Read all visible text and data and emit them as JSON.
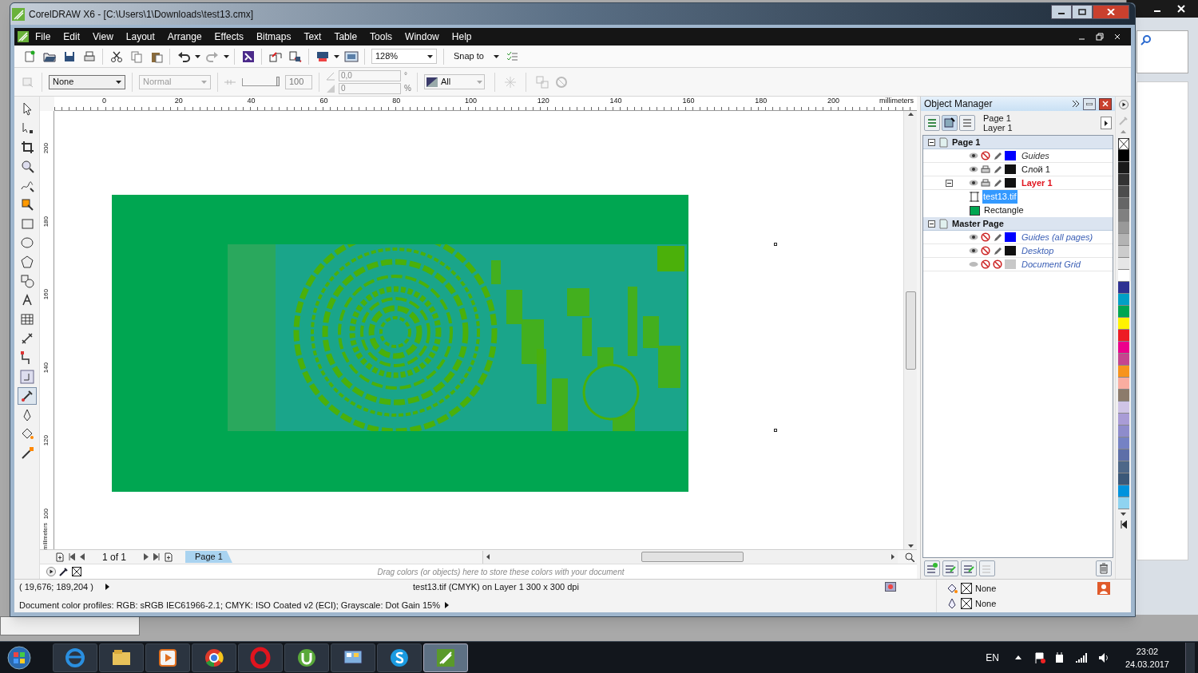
{
  "window": {
    "title": "CorelDRAW X6 - [C:\\Users\\1\\Downloads\\test13.cmx]"
  },
  "menu": {
    "items": [
      {
        "label": "File"
      },
      {
        "label": "Edit"
      },
      {
        "label": "View"
      },
      {
        "label": "Layout"
      },
      {
        "label": "Arrange"
      },
      {
        "label": "Effects"
      },
      {
        "label": "Bitmaps"
      },
      {
        "label": "Text"
      },
      {
        "label": "Table"
      },
      {
        "label": "Tools"
      },
      {
        "label": "Window"
      },
      {
        "label": "Help"
      }
    ]
  },
  "toolbar": {
    "zoom": "128%",
    "snap": "Snap to"
  },
  "property_bar": {
    "outline_width": "None",
    "merge_mode": "Normal",
    "transparency": "100",
    "transparency_slider": {
      "level": 1
    },
    "angle": "0,0",
    "angle_unit": "°",
    "amount": "0",
    "amount_unit": "%",
    "target": "All"
  },
  "rulers": {
    "horizontal": [
      "0",
      "20",
      "40",
      "60",
      "80",
      "100",
      "120",
      "140",
      "160",
      "180",
      "200"
    ],
    "horizontal_unit": "millimeters",
    "vertical": [
      "200",
      "180",
      "160",
      "140",
      "120",
      "100"
    ],
    "vertical_unit": "millimeters"
  },
  "page_nav": {
    "position": "1 of 1",
    "tabs": [
      {
        "label": "Page 1",
        "selected": true
      }
    ]
  },
  "color_docker": {
    "hint": "Drag colors (or objects) here to store these colors with your document"
  },
  "object_manager": {
    "title": "Object Manager",
    "current_page": "Page 1",
    "current_layer": "Layer 1",
    "tree": [
      {
        "kind": "page",
        "label": "Page 1",
        "expanded": true,
        "children": [
          {
            "kind": "special-layer",
            "label": "Guides",
            "color": "#0000ff",
            "visible": true,
            "printable": false,
            "editable": true,
            "active": false
          },
          {
            "kind": "layer",
            "label": "Слой 1",
            "color": "#111111",
            "visible": true,
            "printable": true,
            "editable": true,
            "active": false
          },
          {
            "kind": "layer",
            "label": "Layer 1",
            "color": "#111111",
            "visible": true,
            "printable": true,
            "editable": true,
            "active": true,
            "expanded": true,
            "children": [
              {
                "kind": "bitmap",
                "label": "test13.tif",
                "selected": true
              },
              {
                "kind": "rectangle",
                "label": "Rectangle",
                "selected": false,
                "color": "#00a651"
              }
            ]
          }
        ]
      },
      {
        "kind": "page",
        "label": "Master Page",
        "expanded": true,
        "children": [
          {
            "kind": "master-layer",
            "label": "Guides (all pages)",
            "color": "#0000ff",
            "visible": true,
            "printable": false,
            "editable": true,
            "active": false
          },
          {
            "kind": "master-layer",
            "label": "Desktop",
            "color": "#111111",
            "visible": true,
            "printable": false,
            "editable": true,
            "active": false
          },
          {
            "kind": "master-layer",
            "label": "Document Grid",
            "color": "#c8c8c8",
            "visible": false,
            "printable": false,
            "editable": false,
            "active": false
          }
        ]
      }
    ]
  },
  "palette": {
    "swatches": [
      {
        "color": "#000000"
      },
      {
        "color": "#1a1a1a"
      },
      {
        "color": "#333333"
      },
      {
        "color": "#4d4d4d"
      },
      {
        "color": "#666666"
      },
      {
        "color": "#808080"
      },
      {
        "color": "#999999"
      },
      {
        "color": "#b3b3b3"
      },
      {
        "color": "#cccccc"
      },
      {
        "color": "#e6e6e6"
      },
      {
        "color": "#ffffff"
      },
      {
        "color": "#2e3192"
      },
      {
        "color": "#00a0c6"
      },
      {
        "color": "#00a651"
      },
      {
        "color": "#fff200"
      },
      {
        "color": "#ed1c24"
      },
      {
        "color": "#ec008c"
      },
      {
        "color": "#c5458f"
      },
      {
        "color": "#f7941d"
      },
      {
        "color": "#f9ada0"
      },
      {
        "color": "#8c7b6b"
      },
      {
        "color": "#cfc4e6"
      },
      {
        "color": "#a99cd6"
      },
      {
        "color": "#8e8ccc"
      },
      {
        "color": "#7582c4"
      },
      {
        "color": "#5d6fa8"
      },
      {
        "color": "#4d6788"
      },
      {
        "color": "#3b5878"
      },
      {
        "color": "#0093dd"
      },
      {
        "color": "#8fd3f0"
      }
    ]
  },
  "status_bar": {
    "coordinates": "( 19,676; 189,204 )",
    "object_info": "test13.tif (CMYK) on Layer 1 300 x 300 dpi",
    "color_profiles": "Document color profiles: RGB: sRGB IEC61966-2.1; CMYK: ISO Coated v2 (ECI); Grayscale: Dot Gain 15%",
    "fill": "None",
    "outline": "None"
  },
  "taskbar": {
    "apps": [
      {
        "selected": false
      },
      {
        "selected": false
      },
      {
        "selected": false
      },
      {
        "selected": false
      },
      {
        "selected": false
      },
      {
        "selected": false
      },
      {
        "selected": false
      },
      {
        "selected": false
      },
      {
        "selected": true
      }
    ],
    "language": "EN",
    "time": "23:02",
    "date": "24.03.2017"
  }
}
